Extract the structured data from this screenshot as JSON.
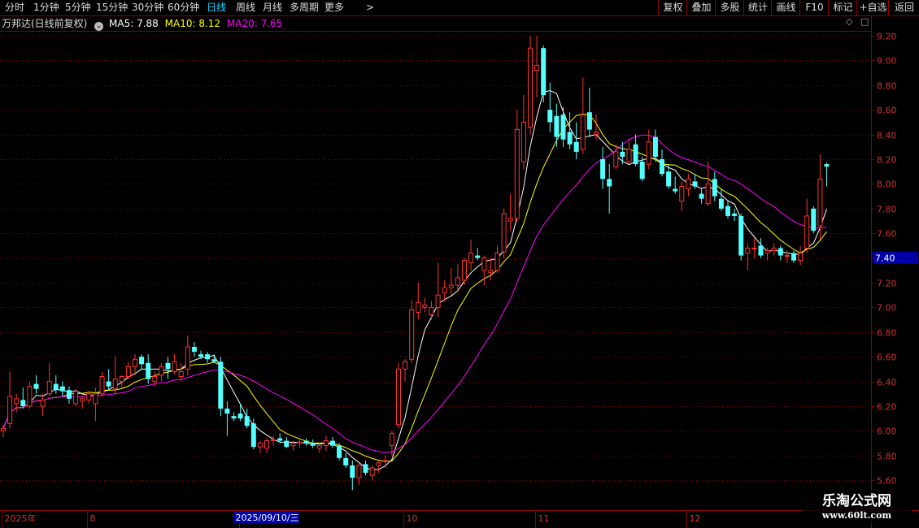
{
  "toolbar": {
    "left_tabs": [
      "分时",
      "1分钟",
      "5分钟",
      "15分钟",
      "30分钟",
      "60分钟",
      "日线",
      "周线",
      "月线",
      "多周期",
      "更多"
    ],
    "active_tab": "日线",
    "more_arrow": ">",
    "right_buttons": [
      "复权",
      "叠加",
      "多股",
      "统计",
      "画线",
      "F10",
      "标记",
      "+自选",
      "返回"
    ]
  },
  "legend": {
    "stock_title": "万邦达(日线前复权)",
    "ma5_label": "MA5: 7.88",
    "ma10_label": "MA10: 8.12",
    "ma20_label": "MA20: 7.65",
    "ma5_color": "#ffffff",
    "ma10_color": "#ffff00",
    "ma20_color": "#ff00ff"
  },
  "colors": {
    "up": "#ff3232",
    "down": "#54ffff",
    "grid": "#8b0000",
    "price_tag_bg": "#0000a8"
  },
  "current_price_tag": "7.40",
  "date_cursor_label": "2025/09/10/三",
  "watermark": {
    "line1": "乐淘公式网",
    "line2": "www.60lt.com"
  },
  "chart_data": {
    "type": "candlestick",
    "ylim": [
      5.52,
      9.28
    ],
    "yticks": [
      "9.20",
      "9.00",
      "8.80",
      "8.60",
      "8.40",
      "8.20",
      "8.00",
      "7.80",
      "7.60",
      "7.40",
      "7.20",
      "7.00",
      "6.80",
      "6.60",
      "6.40",
      "6.20",
      "6.00",
      "5.80",
      "5.60"
    ],
    "xticks": [
      {
        "label": "2025年",
        "index": 0
      },
      {
        "label": "8",
        "index": 13
      },
      {
        "label": "9",
        "index": 36
      },
      {
        "label": "10",
        "index": 61
      },
      {
        "label": "11",
        "index": 81
      },
      {
        "label": "12",
        "index": 104
      }
    ],
    "cursor_index": 45,
    "candles": [
      [
        6.0,
        6.05,
        5.95,
        6.02
      ],
      [
        6.06,
        6.48,
        6.02,
        6.28
      ],
      [
        6.22,
        6.3,
        6.15,
        6.26
      ],
      [
        6.25,
        6.35,
        6.18,
        6.2
      ],
      [
        6.2,
        6.4,
        6.18,
        6.36
      ],
      [
        6.38,
        6.45,
        6.3,
        6.34
      ],
      [
        6.2,
        6.3,
        6.12,
        6.25
      ],
      [
        6.3,
        6.55,
        6.28,
        6.4
      ],
      [
        6.38,
        6.45,
        6.3,
        6.33
      ],
      [
        6.36,
        6.4,
        6.28,
        6.32
      ],
      [
        6.33,
        6.36,
        6.22,
        6.26
      ],
      [
        6.22,
        6.34,
        6.2,
        6.32
      ],
      [
        6.24,
        6.28,
        6.18,
        6.26
      ],
      [
        6.25,
        6.32,
        6.22,
        6.3
      ],
      [
        6.22,
        6.35,
        6.08,
        6.3
      ],
      [
        6.3,
        6.48,
        6.28,
        6.44
      ],
      [
        6.4,
        6.5,
        6.34,
        6.36
      ],
      [
        6.34,
        6.6,
        6.3,
        6.42
      ],
      [
        6.4,
        6.45,
        6.35,
        6.44
      ],
      [
        6.44,
        6.56,
        6.42,
        6.52
      ],
      [
        6.52,
        6.62,
        6.45,
        6.58
      ],
      [
        6.6,
        6.62,
        6.5,
        6.54
      ],
      [
        6.55,
        6.62,
        6.38,
        6.42
      ],
      [
        6.4,
        6.48,
        6.36,
        6.44
      ],
      [
        6.45,
        6.55,
        6.4,
        6.52
      ],
      [
        6.55,
        6.6,
        6.42,
        6.5
      ],
      [
        6.48,
        6.62,
        6.46,
        6.56
      ],
      [
        6.44,
        6.55,
        6.4,
        6.48
      ],
      [
        6.5,
        6.77,
        6.45,
        6.68
      ],
      [
        6.68,
        6.72,
        6.6,
        6.64
      ],
      [
        6.62,
        6.65,
        6.58,
        6.6
      ],
      [
        6.62,
        6.64,
        6.55,
        6.58
      ],
      [
        6.58,
        6.62,
        6.55,
        6.56
      ],
      [
        6.56,
        6.6,
        6.12,
        6.18
      ],
      [
        6.18,
        6.24,
        5.96,
        6.14
      ],
      [
        6.12,
        6.15,
        6.08,
        6.1
      ],
      [
        6.14,
        6.22,
        6.08,
        6.1
      ],
      [
        6.12,
        6.18,
        6.02,
        6.04
      ],
      [
        6.06,
        6.1,
        5.85,
        5.87
      ],
      [
        5.87,
        5.92,
        5.82,
        5.9
      ],
      [
        5.86,
        5.94,
        5.82,
        5.92
      ],
      [
        5.92,
        5.96,
        5.88,
        5.93
      ],
      [
        5.94,
        5.98,
        5.9,
        5.92
      ],
      [
        5.92,
        5.95,
        5.86,
        5.87
      ],
      [
        5.88,
        5.92,
        5.84,
        5.9
      ],
      [
        5.9,
        5.94,
        5.86,
        5.91
      ],
      [
        5.92,
        5.94,
        5.88,
        5.9
      ],
      [
        5.9,
        5.93,
        5.86,
        5.88
      ],
      [
        5.86,
        5.9,
        5.82,
        5.88
      ],
      [
        5.88,
        5.96,
        5.84,
        5.92
      ],
      [
        5.92,
        5.95,
        5.86,
        5.88
      ],
      [
        5.88,
        5.9,
        5.76,
        5.78
      ],
      [
        5.78,
        5.82,
        5.7,
        5.72
      ],
      [
        5.72,
        5.76,
        5.52,
        5.62
      ],
      [
        5.62,
        5.74,
        5.56,
        5.72
      ],
      [
        5.73,
        5.76,
        5.64,
        5.66
      ],
      [
        5.64,
        5.72,
        5.6,
        5.7
      ],
      [
        5.72,
        5.76,
        5.66,
        5.74
      ],
      [
        5.76,
        5.8,
        5.7,
        5.76
      ],
      [
        5.88,
        6.0,
        5.8,
        5.98
      ],
      [
        6.05,
        6.55,
        6.02,
        6.5
      ],
      [
        6.5,
        6.58,
        6.4,
        6.56
      ],
      [
        6.58,
        7.06,
        6.55,
        6.98
      ],
      [
        6.96,
        7.2,
        6.9,
        7.04
      ],
      [
        7.0,
        7.08,
        6.96,
        7.02
      ],
      [
        6.94,
        7.05,
        6.9,
        7.0
      ],
      [
        7.0,
        7.36,
        6.92,
        7.1
      ],
      [
        7.12,
        7.22,
        7.05,
        7.16
      ],
      [
        7.16,
        7.32,
        7.1,
        7.18
      ],
      [
        7.18,
        7.35,
        7.12,
        7.24
      ],
      [
        7.22,
        7.4,
        7.18,
        7.38
      ],
      [
        7.36,
        7.55,
        7.3,
        7.44
      ],
      [
        7.42,
        7.48,
        7.38,
        7.4
      ],
      [
        7.3,
        7.42,
        7.18,
        7.4
      ],
      [
        7.28,
        7.4,
        7.22,
        7.3
      ],
      [
        7.3,
        7.5,
        7.28,
        7.44
      ],
      [
        7.45,
        7.8,
        7.4,
        7.76
      ],
      [
        7.7,
        7.92,
        7.62,
        7.72
      ],
      [
        7.72,
        8.6,
        7.7,
        8.44
      ],
      [
        8.18,
        8.72,
        8.12,
        8.5
      ],
      [
        8.46,
        9.2,
        8.4,
        9.1
      ],
      [
        8.92,
        9.2,
        8.7,
        8.96
      ],
      [
        9.1,
        9.12,
        8.66,
        8.72
      ],
      [
        8.6,
        8.82,
        8.42,
        8.5
      ],
      [
        8.55,
        8.65,
        8.3,
        8.38
      ],
      [
        8.56,
        8.62,
        8.3,
        8.36
      ],
      [
        8.42,
        8.58,
        8.28,
        8.32
      ],
      [
        8.34,
        8.5,
        8.2,
        8.26
      ],
      [
        8.28,
        8.86,
        8.24,
        8.56
      ],
      [
        8.58,
        8.78,
        8.38,
        8.44
      ],
      [
        8.4,
        8.56,
        8.36,
        8.42
      ],
      [
        8.2,
        8.3,
        7.96,
        8.04
      ],
      [
        8.04,
        8.16,
        7.76,
        7.98
      ],
      [
        8.14,
        8.32,
        8.12,
        8.26
      ],
      [
        8.26,
        8.34,
        8.16,
        8.22
      ],
      [
        8.18,
        8.36,
        8.16,
        8.28
      ],
      [
        8.32,
        8.4,
        8.14,
        8.16
      ],
      [
        8.18,
        8.22,
        8.02,
        8.04
      ],
      [
        8.16,
        8.44,
        8.12,
        8.34
      ],
      [
        8.38,
        8.44,
        8.18,
        8.22
      ],
      [
        8.2,
        8.28,
        8.06,
        8.08
      ],
      [
        8.1,
        8.16,
        7.96,
        7.98
      ],
      [
        7.96,
        8.06,
        7.92,
        7.94
      ],
      [
        7.86,
        8.02,
        7.78,
        7.98
      ],
      [
        7.96,
        8.08,
        7.9,
        8.04
      ],
      [
        8.02,
        8.08,
        7.96,
        7.98
      ],
      [
        7.92,
        7.96,
        7.84,
        7.88
      ],
      [
        7.84,
        8.18,
        7.82,
        8.0
      ],
      [
        8.04,
        8.1,
        7.86,
        7.9
      ],
      [
        7.88,
        7.96,
        7.78,
        7.8
      ],
      [
        7.82,
        7.86,
        7.72,
        7.74
      ],
      [
        7.76,
        7.8,
        7.7,
        7.74
      ],
      [
        7.74,
        7.76,
        7.38,
        7.42
      ],
      [
        7.44,
        7.52,
        7.3,
        7.48
      ],
      [
        7.48,
        7.56,
        7.4,
        7.48
      ],
      [
        7.5,
        7.56,
        7.4,
        7.42
      ],
      [
        7.44,
        7.48,
        7.38,
        7.46
      ],
      [
        7.46,
        7.52,
        7.42,
        7.48
      ],
      [
        7.48,
        7.5,
        7.38,
        7.42
      ],
      [
        7.42,
        7.46,
        7.36,
        7.42
      ],
      [
        7.44,
        7.46,
        7.36,
        7.38
      ],
      [
        7.38,
        7.5,
        7.34,
        7.44
      ],
      [
        7.48,
        7.88,
        7.44,
        7.74
      ],
      [
        7.8,
        7.82,
        7.6,
        7.62
      ],
      [
        7.66,
        8.24,
        7.55,
        8.04
      ],
      [
        8.16,
        8.17,
        7.98,
        8.14
      ]
    ]
  }
}
